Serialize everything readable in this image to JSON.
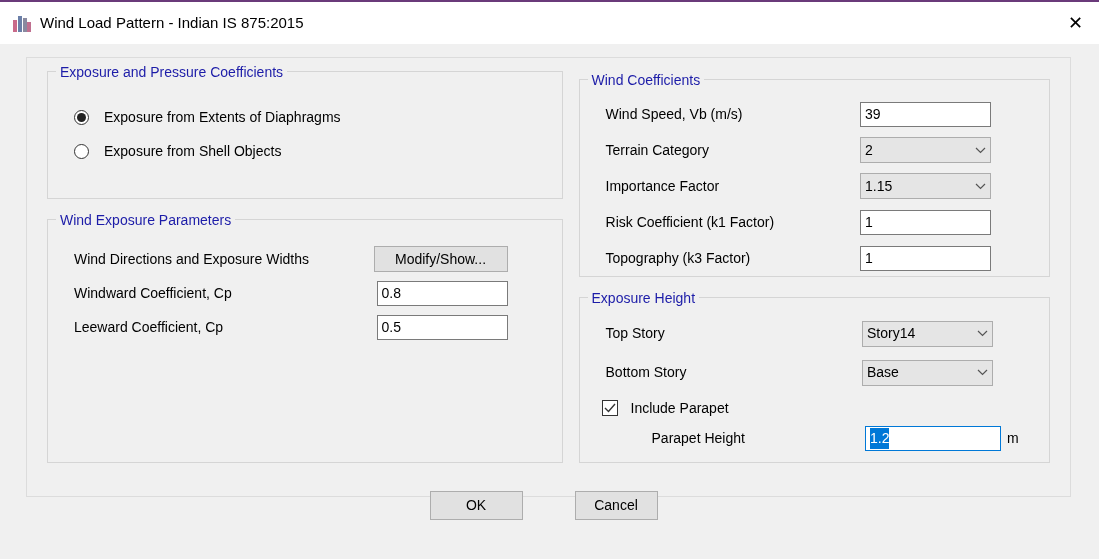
{
  "window": {
    "title": "Wind Load Pattern - Indian IS 875:2015",
    "close": "✕"
  },
  "exposure_group": {
    "legend": "Exposure and Pressure Coefficients",
    "options": [
      {
        "label": "Exposure from Extents of Diaphragms",
        "selected": true
      },
      {
        "label": "Exposure from Shell Objects",
        "selected": false
      }
    ]
  },
  "wind_exposure": {
    "legend": "Wind Exposure Parameters",
    "rows": [
      {
        "kind": "button",
        "label": "Wind Directions and Exposure Widths",
        "value": "Modify/Show..."
      },
      {
        "kind": "text",
        "label": "Windward Coefficient, Cp",
        "value": "0.8"
      },
      {
        "kind": "text",
        "label": "Leeward Coefficient, Cp",
        "value": "0.5"
      }
    ]
  },
  "wind_coefficients": {
    "legend": "Wind Coefficients",
    "rows": [
      {
        "kind": "text",
        "label": "Wind Speed, Vb (m/s)",
        "value": "39"
      },
      {
        "kind": "select",
        "label": "Terrain Category",
        "value": "2"
      },
      {
        "kind": "select",
        "label": "Importance Factor",
        "value": "1.15"
      },
      {
        "kind": "text",
        "label": "Risk Coefficient (k1 Factor)",
        "value": "1"
      },
      {
        "kind": "text",
        "label": "Topography (k3 Factor)",
        "value": "1"
      }
    ]
  },
  "exposure_height": {
    "legend": "Exposure Height",
    "rows": [
      {
        "kind": "select",
        "label": "Top Story",
        "value": "Story14"
      },
      {
        "kind": "select",
        "label": "Bottom Story",
        "value": "Base"
      }
    ],
    "include_parapet": {
      "label": "Include Parapet",
      "checked": true
    },
    "parapet_height": {
      "label": "Parapet Height",
      "value": "1.2",
      "highlighted": true,
      "unit": "m"
    }
  },
  "buttons": [
    "OK",
    "Cancel"
  ]
}
